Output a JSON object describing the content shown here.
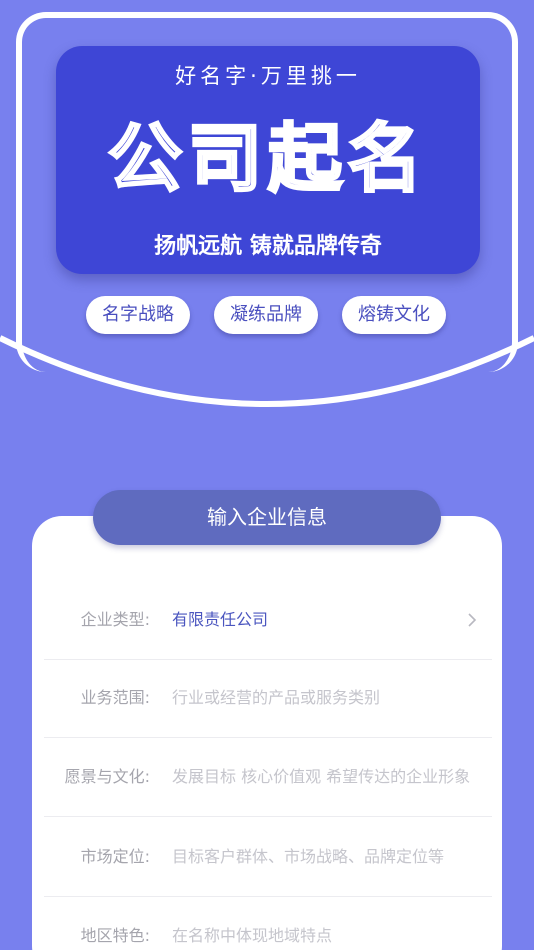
{
  "hero": {
    "tagline": "好名字·万里挑一",
    "title": "公司起名",
    "subtitle": "扬帆远航 铸就品牌传奇",
    "pills": [
      "名字战略",
      "凝练品牌",
      "熔铸文化"
    ]
  },
  "form": {
    "header": "输入企业信息",
    "fields": [
      {
        "label": "企业类型:",
        "value": "有限责任公司"
      },
      {
        "label": "业务范围:",
        "placeholder": "行业或经营的产品或服务类别"
      },
      {
        "label": "愿景与文化:",
        "placeholder": "发展目标 核心价值观 希望传达的企业形象"
      },
      {
        "label": "市场定位:",
        "placeholder": "目标客户群体、市场战略、品牌定位等"
      },
      {
        "label": "地区特色:",
        "placeholder": "在名称中体现地域特点"
      }
    ]
  },
  "colors": {
    "background": "#7880ee",
    "hero_card": "#3e46d6",
    "form_header": "#5f6bbf",
    "accent_text": "#4a55bf"
  }
}
